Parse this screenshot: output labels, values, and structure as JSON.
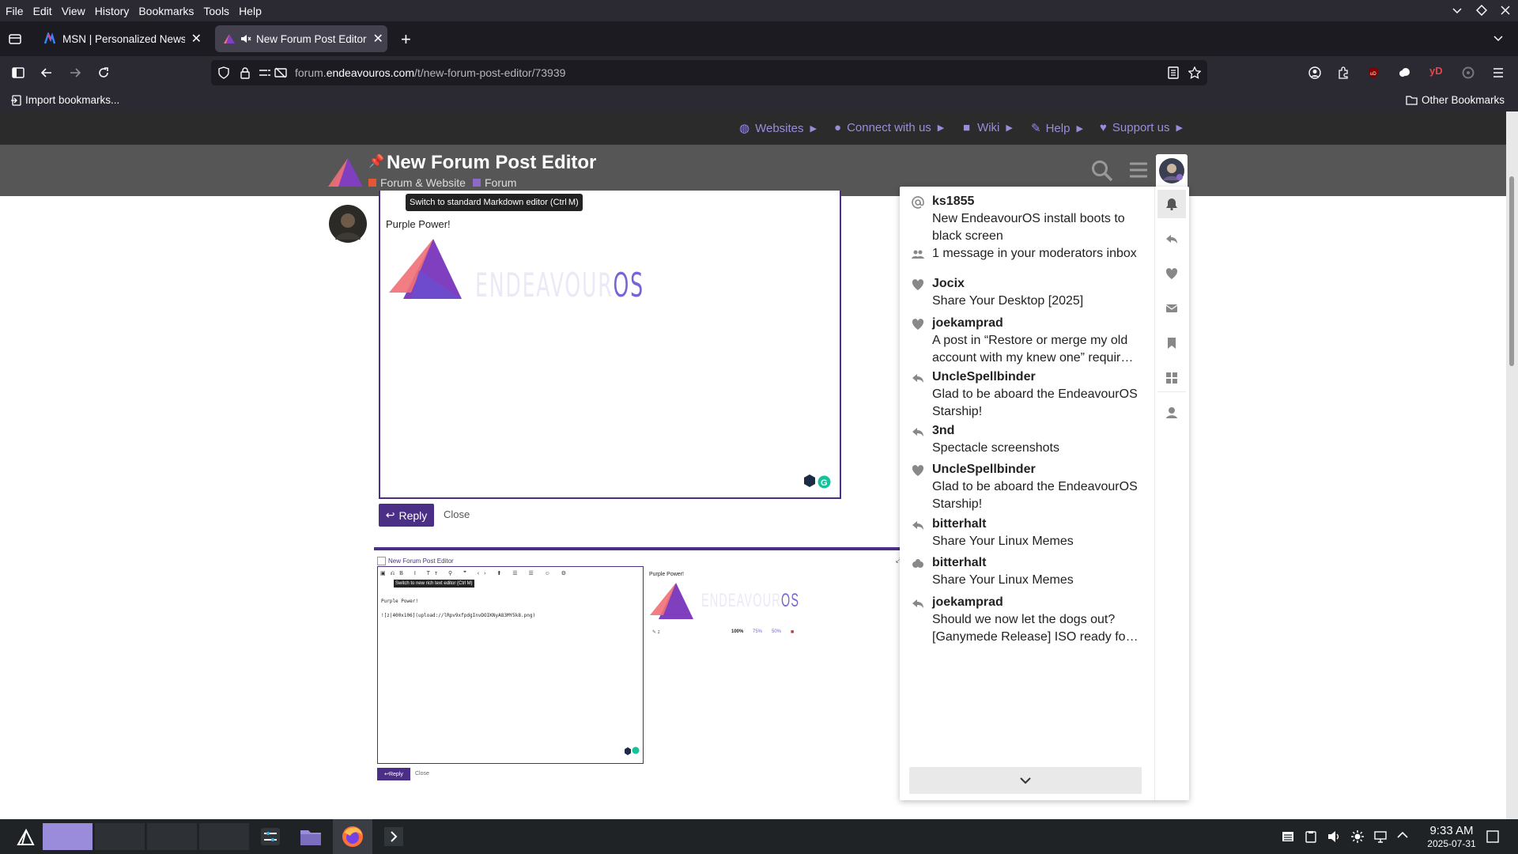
{
  "menubar": {
    "items": [
      "File",
      "Edit",
      "View",
      "History",
      "Bookmarks",
      "Tools",
      "Help"
    ]
  },
  "tabs": [
    {
      "title": "MSN | Personalized News,"
    },
    {
      "title": "New Forum Post Editor"
    }
  ],
  "url": {
    "prefix": "forum.",
    "domain": "endeavouros.com",
    "path": "/t/new-forum-post-editor/73939"
  },
  "bookmarks": {
    "import": "Import bookmarks...",
    "other": "Other Bookmarks"
  },
  "site_nav": {
    "items": [
      "Websites",
      "Connect with us",
      "Wiki",
      "Help",
      "Support us"
    ]
  },
  "topic": {
    "title": "New Forum Post Editor",
    "category": "Forum & Website",
    "subcategory": "Forum",
    "category_color": "#e45735",
    "subcategory_color": "#8c6bc7"
  },
  "editor": {
    "tooltip": "Switch to standard Markdown editor (Ctrl M)",
    "body": "Purple Power!",
    "logo_main": "ENDEAVOUR",
    "logo_os": "OS",
    "reply": "Reply",
    "close": "Close"
  },
  "preview": {
    "title": "New Forum Post Editor",
    "tooltip": "Switch to new rich text editor (Ctrl M)",
    "body_line1": "Purple Power!",
    "body_line2": "![z|400x106](upload://lRpv9xfpdgInvDOIKNyA83MY5k8.png)",
    "preview_text": "Purple Power!",
    "img_label": "z",
    "zoom": [
      "100%",
      "75%",
      "50%"
    ],
    "reply": "Reply",
    "close": "Close",
    "logo_main": "ENDEAVOUR",
    "logo_os": "OS"
  },
  "notifications": [
    {
      "icon": "at-icon",
      "user": "ks1855",
      "text": "New EndeavourOS install boots to black screen"
    },
    {
      "icon": "users-icon",
      "user": "",
      "text": "1 message in your moderators inbox"
    },
    {
      "icon": "heart-icon",
      "user": "Jocix",
      "text": "Share Your Desktop [2025]"
    },
    {
      "icon": "heart-icon",
      "user": "joekamprad",
      "text": "A post in “Restore or merge my old account with my knew one” requir…"
    },
    {
      "icon": "reply-icon",
      "user": "UncleSpellbinder",
      "text": "Glad to be aboard the EndeavourOS Starship!"
    },
    {
      "icon": "reply-icon",
      "user": "3nd",
      "text": "Spectacle screenshots"
    },
    {
      "icon": "heart-icon",
      "user": "UncleSpellbinder",
      "text": "Glad to be aboard the EndeavourOS Starship!"
    },
    {
      "icon": "reply-icon",
      "user": "bitterhalt",
      "text": "Share Your Linux Memes"
    },
    {
      "icon": "reaction-icon",
      "user": "bitterhalt",
      "text": "Share Your Linux Memes"
    },
    {
      "icon": "reply-icon",
      "user": "joekamprad",
      "text": "Should we now let the dogs out? [Ganymede Release] ISO ready fo…"
    }
  ],
  "taskbar": {
    "time": "9:33 AM",
    "date": "2025-07-31"
  },
  "colors": {
    "accent": "#4b2f86",
    "link": "#9b8cdb"
  }
}
